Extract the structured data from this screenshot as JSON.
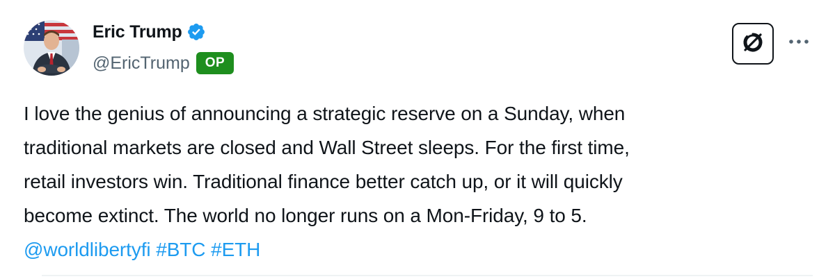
{
  "author": {
    "display_name": "Eric Trump",
    "handle": "@EricTrump",
    "verified_icon": "verified-badge-icon",
    "badge": "OP",
    "avatar_icon": "avatar"
  },
  "actions": {
    "grok_icon": "grok-icon",
    "more_icon": "more-options-icon"
  },
  "tweet": {
    "lines": [
      "I love the genius of announcing a strategic reserve on a Sunday, when",
      "traditional markets are closed and Wall Street sleeps. For the first time,",
      "retail investors win. Traditional finance better catch up, or it will quickly",
      "become extinct. The world no longer runs on a Mon-Friday, 9 to 5."
    ],
    "mention": "@worldlibertyfi",
    "hashtags": [
      "#BTC",
      "#ETH"
    ]
  },
  "colors": {
    "link": "#1d9bf0",
    "verified": "#1d9bf0",
    "op_badge": "#1e8e1e",
    "secondary_text": "#536471"
  }
}
